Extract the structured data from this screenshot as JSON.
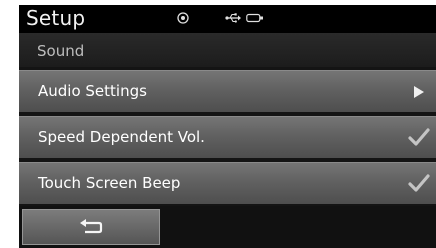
{
  "header": {
    "title": "Setup",
    "status_icons": [
      "gps-icon",
      "usb-icon",
      "ipod-icon"
    ]
  },
  "breadcrumb": {
    "label": "Sound"
  },
  "menu": {
    "items": [
      {
        "label": "Audio Settings",
        "indicator": "chevron-right-icon"
      },
      {
        "label": "Speed Dependent Vol.",
        "indicator": "checkmark-icon",
        "checked": true
      },
      {
        "label": "Touch Screen Beep",
        "indicator": "checkmark-icon",
        "checked": true
      }
    ]
  },
  "footer": {
    "back_icon": "back-arrow-icon"
  },
  "colors": {
    "screen_bg": "#141414",
    "row_bg": "#666666",
    "text": "#ffffff",
    "check": "#bfbfbf"
  }
}
